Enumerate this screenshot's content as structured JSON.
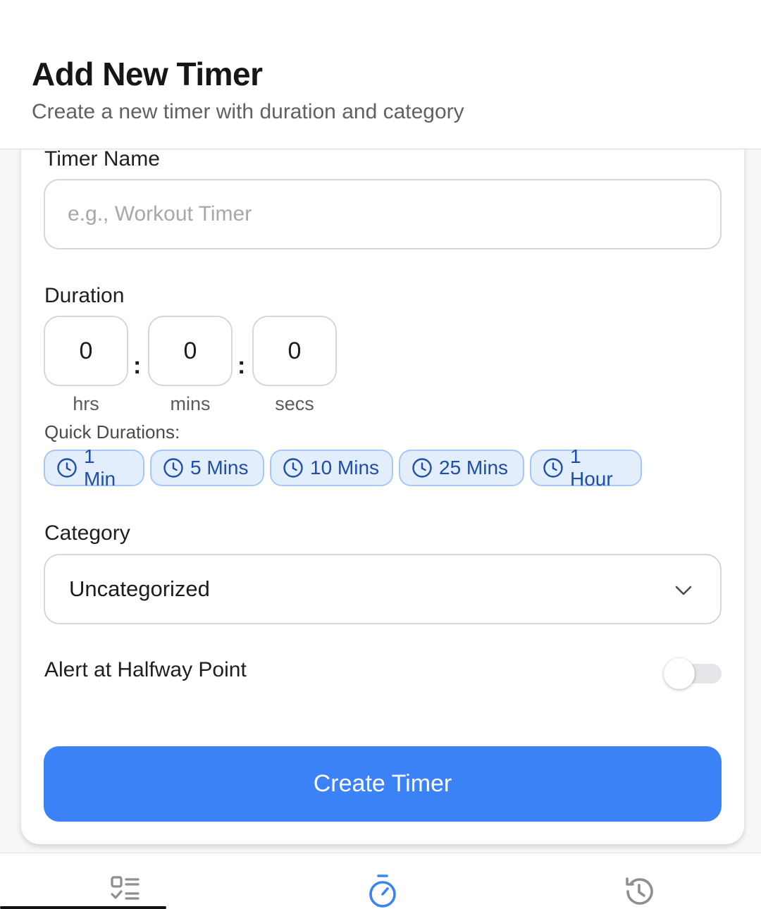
{
  "header": {
    "title": "Add New Timer",
    "subtitle": "Create a new timer with duration and category"
  },
  "form": {
    "name_label": "Timer Name",
    "name_placeholder": "e.g., Workout Timer",
    "name_value": "",
    "duration_label": "Duration",
    "duration": {
      "hours": "0",
      "minutes": "0",
      "seconds": "0",
      "separator": ":",
      "units": {
        "hours": "hrs",
        "minutes": "mins",
        "seconds": "secs"
      }
    },
    "quick_label": "Quick Durations:",
    "quick_durations": [
      "1 Min",
      "5 Mins",
      "10 Mins",
      "25 Mins",
      "1 Hour"
    ],
    "category_label": "Category",
    "category_value": "Uncategorized",
    "alert_label": "Alert at Halfway Point",
    "alert_enabled": false,
    "submit_label": "Create Timer"
  },
  "tabbar": {
    "items": [
      {
        "icon": "list-check-icon",
        "active": false
      },
      {
        "icon": "stopwatch-icon",
        "active": true
      },
      {
        "icon": "history-icon",
        "active": false
      }
    ]
  },
  "colors": {
    "accent": "#3b82f6",
    "chip_bg": "#e3eefc",
    "chip_border": "#a6c8f5",
    "chip_text": "#1e4ea8",
    "inactive_icon": "#8e8e93"
  }
}
